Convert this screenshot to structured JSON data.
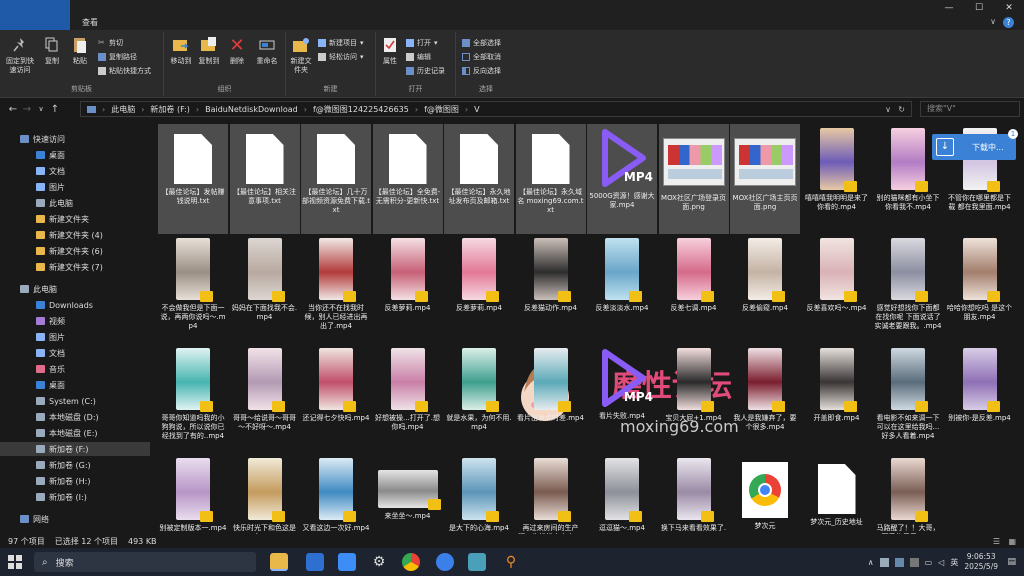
{
  "window": {
    "title": "V"
  },
  "menu_tabs": [
    "文件",
    "主页",
    "共享",
    "查看"
  ],
  "ribbon": {
    "pin_label": "固定到快速访问",
    "copy_label": "复制",
    "paste_label": "粘贴",
    "cut_label": "剪切",
    "copy_path_label": "复制路径",
    "paste_shortcut_label": "粘贴快捷方式",
    "clipboard_group": "剪贴板",
    "move_to_label": "移动到",
    "copy_to_label": "复制到",
    "delete_label": "删除",
    "rename_label": "重命名",
    "organize_group": "组织",
    "new_folder_label": "新建文件夹",
    "new_item_label": "新建项目",
    "easy_access_label": "轻松访问",
    "new_group": "新建",
    "properties_label": "属性",
    "open_label": "打开",
    "edit_label": "编辑",
    "history_label": "历史记录",
    "open_group": "打开",
    "select_all_label": "全部选择",
    "select_none_label": "全部取消",
    "invert_label": "反向选择",
    "select_group": "选择"
  },
  "address": {
    "segments": [
      "此电脑",
      "新加卷 (F:)",
      "BaiduNetdiskDownload",
      "f@微图图124225426635",
      "f@微图图",
      "V"
    ],
    "search_placeholder": "搜索\"V\""
  },
  "sidebar": {
    "items": [
      {
        "label": "快速访问",
        "pinned": false
      },
      {
        "label": "桌面",
        "pinned": true
      },
      {
        "label": "文档",
        "pinned": true
      },
      {
        "label": "图片",
        "pinned": true
      },
      {
        "label": "此电脑",
        "pinned": true
      },
      {
        "label": "新建文件夹",
        "pinned": false
      },
      {
        "label": "新建文件夹 (4)",
        "pinned": false
      },
      {
        "label": "新建文件夹 (6)",
        "pinned": false
      },
      {
        "label": "新建文件夹 (7)",
        "pinned": false
      },
      {
        "label": "此电脑",
        "pinned": false
      },
      {
        "label": "Downloads",
        "pinned": false
      },
      {
        "label": "视频",
        "pinned": false
      },
      {
        "label": "图片",
        "pinned": false
      },
      {
        "label": "文档",
        "pinned": false
      },
      {
        "label": "音乐",
        "pinned": false
      },
      {
        "label": "桌面",
        "pinned": false
      },
      {
        "label": "System (C:)",
        "pinned": false
      },
      {
        "label": "本地磁盘 (D:)",
        "pinned": false
      },
      {
        "label": "本地磁盘 (E:)",
        "pinned": false
      },
      {
        "label": "新加卷 (F:)",
        "pinned": false
      },
      {
        "label": "新加卷 (G:)",
        "pinned": false
      },
      {
        "label": "新加卷 (H:)",
        "pinned": false
      },
      {
        "label": "新加卷 (I:)",
        "pinned": false
      },
      {
        "label": "网络",
        "pinned": false
      }
    ]
  },
  "files": [
    {
      "name": "【最佳论坛】发帖赚钱说明.txt",
      "kind": "txt",
      "selected": true
    },
    {
      "name": "【最佳论坛】相关注意事项.txt",
      "kind": "txt",
      "selected": true
    },
    {
      "name": "【最佳论坛】几十万部视频资源免费下载.txt",
      "kind": "txt",
      "selected": true
    },
    {
      "name": "【最佳论坛】全免费-无需积分-更新快.txt",
      "kind": "txt",
      "selected": true
    },
    {
      "name": "【最佳论坛】永久地址发布页及邮箱.txt",
      "kind": "txt",
      "selected": true
    },
    {
      "name": "【最佳论坛】永久域名 moxing69.com.txt",
      "kind": "txt",
      "selected": true
    },
    {
      "name": "5000G资源！感谢大家.mp4",
      "kind": "mp4icon",
      "selected": true
    },
    {
      "name": "MOX社区广场登录页面.png",
      "kind": "web",
      "selected": true
    },
    {
      "name": "MOX社区广场主页页面.png",
      "kind": "web",
      "selected": true
    },
    {
      "name": "嘻嘻嘻我明明是来了你看的.mp4",
      "kind": "vid",
      "c1": "#e8c9a3",
      "c2": "#6d5cb8"
    },
    {
      "name": "别的猫咪都有小坐下你看我不.mp4",
      "kind": "vid",
      "c1": "#f6d0e0",
      "c2": "#b37cc4"
    },
    {
      "name": "不管你在哪里都是下载 都在我里面.mp4",
      "kind": "vid",
      "c1": "#f2f2f2",
      "c2": "#d3c5e3"
    },
    {
      "name": "不会做我但是下面一说，再两你说吗～.mp4",
      "kind": "vid",
      "c1": "#e8e0d8",
      "c2": "#9a8f84"
    },
    {
      "name": "妈妈在下面找我不会.mp4",
      "kind": "vid",
      "c1": "#dcd6d2",
      "c2": "#b8a9a0"
    },
    {
      "name": "当你还不在找我时候，别人已经进出再出了.mp4",
      "kind": "vid",
      "c1": "#f0e8e6",
      "c2": "#b33b3b"
    },
    {
      "name": "反差萝莉.mp4",
      "kind": "vid",
      "c1": "#f4e0e4",
      "c2": "#c76077"
    },
    {
      "name": "反差萝莉.mp4",
      "kind": "vid",
      "c1": "#f6d9e2",
      "c2": "#e27896"
    },
    {
      "name": "反差猫动作.mp4",
      "kind": "vid",
      "c1": "#cbbfb9",
      "c2": "#2d2d2d"
    },
    {
      "name": "反差淡淡水.mp4",
      "kind": "vid",
      "c1": "#bfe2f0",
      "c2": "#6aa5c8"
    },
    {
      "name": "反差七调.mp4",
      "kind": "vid",
      "c1": "#f7d0dc",
      "c2": "#d56a8b"
    },
    {
      "name": "反差偷窥.mp4",
      "kind": "vid",
      "c1": "#f3ece6",
      "c2": "#c4b3a4"
    },
    {
      "name": "反差喜欢吗～.mp4",
      "kind": "vid",
      "c1": "#f1e4e1",
      "c2": "#d9b2b7"
    },
    {
      "name": "感觉好想找你下面都在找你呢 下面说话了 实诚老要跟我。.mp4",
      "kind": "vid",
      "c1": "#d9d9df",
      "c2": "#8c8fa1"
    },
    {
      "name": "哈哈你想吃吗 是这个朋友.mp4",
      "kind": "vid",
      "c1": "#efe2da",
      "c2": "#a27e6c"
    },
    {
      "name": "哥哥你知道吗我的小狗狗说，所以说你已经找到了有的..mp4",
      "kind": "vid",
      "c1": "#dff3f2",
      "c2": "#47b4b0"
    },
    {
      "name": "哥哥～给说哥～哥哥～不好呀～.mp4",
      "kind": "vid",
      "c1": "#f2e1e8",
      "c2": "#b29bb3"
    },
    {
      "name": "还记得七夕快吗.mp4",
      "kind": "vid",
      "c1": "#f0e5e0",
      "c2": "#c04f6b"
    },
    {
      "name": "好想被操...打开了.想你吗.mp4",
      "kind": "vid",
      "c1": "#efe3e7",
      "c2": "#c97fa7"
    },
    {
      "name": "就是水果，为何不用.mp4",
      "kind": "vid",
      "c1": "#dcefe8",
      "c2": "#3e9f8e"
    },
    {
      "name": "看片出发点时差.mp4",
      "kind": "vid",
      "c1": "#e7ecef",
      "c2": "#5ba9b7"
    },
    {
      "name": "看片失败.mp4",
      "kind": "mp4icon2"
    },
    {
      "name": "宝贝大屁+1.mp4",
      "kind": "vid",
      "c1": "#f2dede",
      "c2": "#2a2a2a"
    },
    {
      "name": "我人是我嫌弃了，要个很多.mp4",
      "kind": "vid",
      "c1": "#efe0e4",
      "c2": "#7a1e2f"
    },
    {
      "name": "开盖即食.mp4",
      "kind": "vid",
      "c1": "#e6e0dc",
      "c2": "#3a3535"
    },
    {
      "name": "看电影不如来调一下 可以在这里给我吗...好多人看着.mp4",
      "kind": "vid",
      "c1": "#cfd9e2",
      "c2": "#5a6c7b"
    },
    {
      "name": "别被你-是反差.mp4",
      "kind": "vid",
      "c1": "#d8cde6",
      "c2": "#8e6fb5"
    },
    {
      "name": "别被定制版本一.mp4",
      "kind": "vid",
      "c1": "#eaddef",
      "c2": "#b796c6"
    },
    {
      "name": "快乐时光下和色这是一个...mp4",
      "kind": "vid",
      "c1": "#f1ead8",
      "c2": "#c49b5e"
    },
    {
      "name": "又看这边一次好.mp4",
      "kind": "vid",
      "c1": "#dcebf4",
      "c2": "#3f8ac2"
    },
    {
      "name": "来坐坐～.mp4",
      "kind": "vid2",
      "c1": "#e5e5e5",
      "c2": "#8a8a8a"
    },
    {
      "name": "是大下的心海.mp4",
      "kind": "vid",
      "c1": "#cde3ef",
      "c2": "#5c95b8"
    },
    {
      "name": "再过来房间的生产啊，你找找来中来.mp4",
      "kind": "vid",
      "c1": "#e9ddd6",
      "c2": "#7a5b50"
    },
    {
      "name": "逗逗猫～.mp4",
      "kind": "vid",
      "c1": "#e3e3e6",
      "c2": "#8e9099"
    },
    {
      "name": "换下马来看看效果了.mp4",
      "kind": "vid",
      "c1": "#eae6ee",
      "c2": "#9b8ba6"
    },
    {
      "name": "梦次元",
      "kind": "chrome"
    },
    {
      "name": "梦次元_历史地址",
      "kind": "doc"
    },
    {
      "name": "马路醒了！！大哥，可爱的您您.mp4",
      "kind": "vid",
      "c1": "#ead9d1",
      "c2": "#7a5e55"
    }
  ],
  "download_popup": {
    "label": "下载中..."
  },
  "watermark": {
    "title": "磨性论坛",
    "url": "moxing69.com"
  },
  "status": {
    "count": "97 个项目",
    "selection": "已选择 12 个项目",
    "size": "493 KB"
  },
  "taskbar": {
    "search_placeholder": "搜索",
    "ime": "英",
    "time": "9:06:53",
    "date": "2025/5/9"
  }
}
